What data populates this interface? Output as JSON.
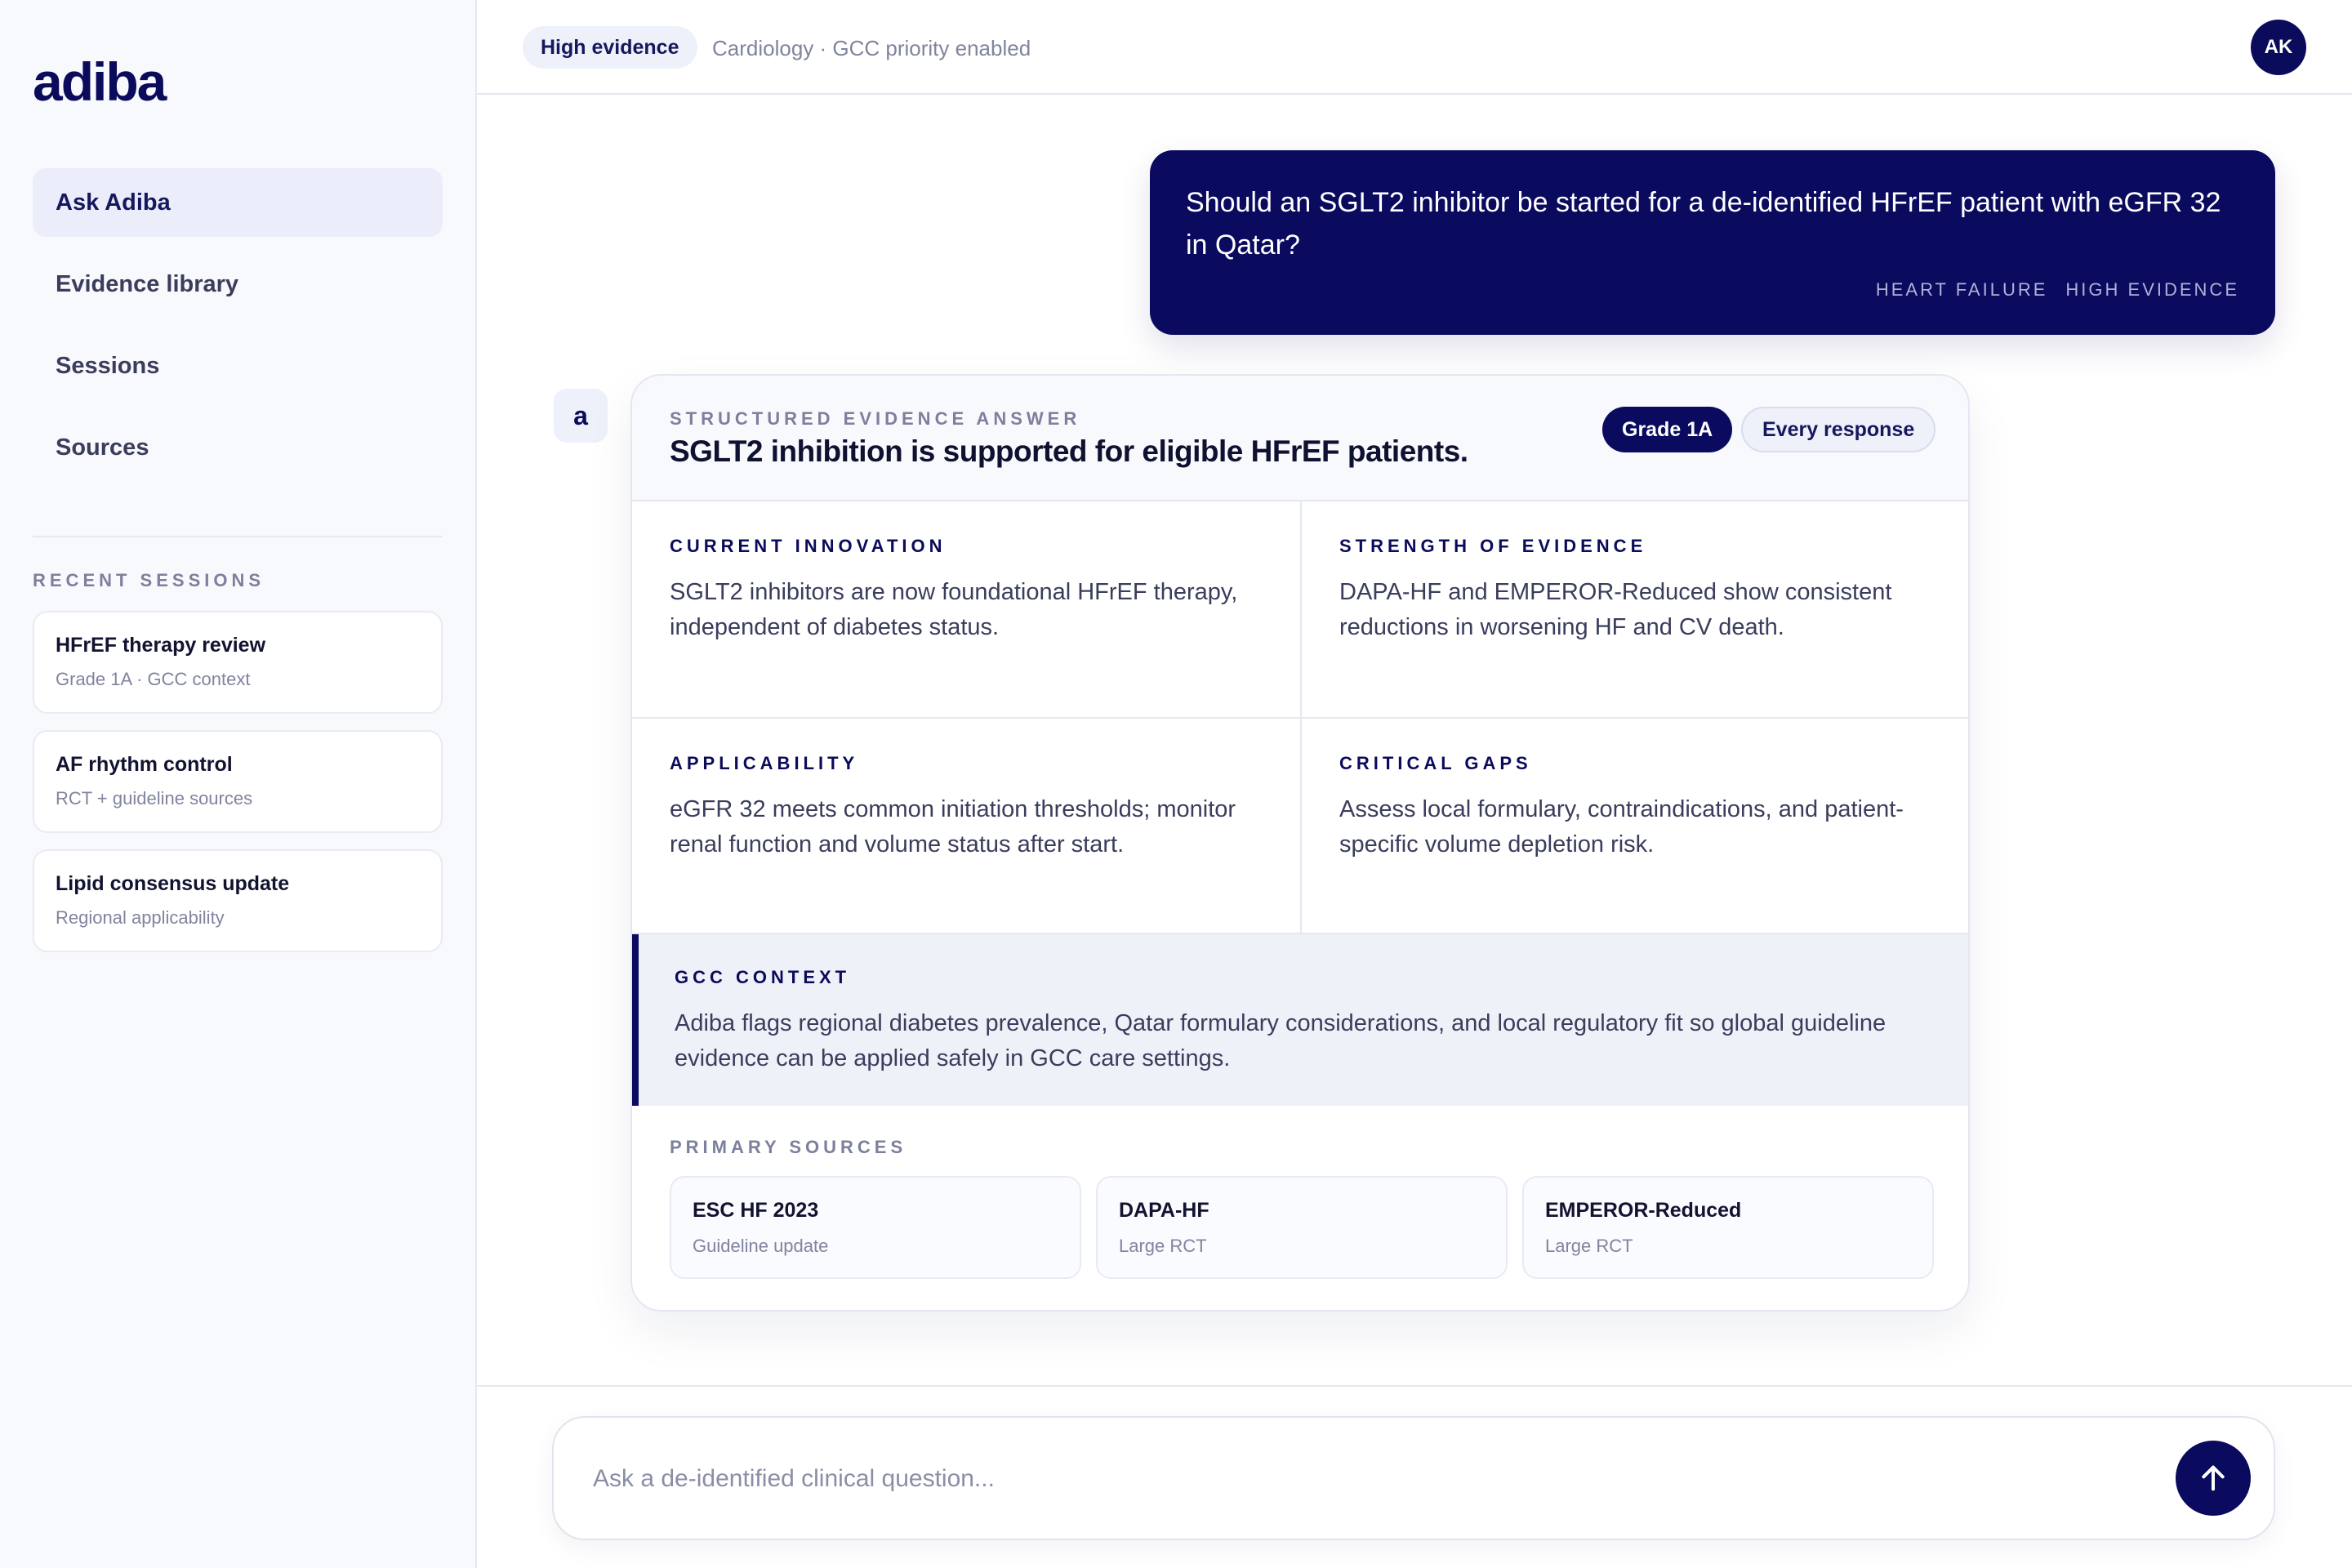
{
  "app": {
    "logo": "adiba"
  },
  "sidebar": {
    "nav": [
      {
        "label": "Ask Adiba",
        "active": true
      },
      {
        "label": "Evidence library",
        "active": false
      },
      {
        "label": "Sessions",
        "active": false
      },
      {
        "label": "Sources",
        "active": false
      }
    ],
    "recent_label": "RECENT SESSIONS",
    "sessions": [
      {
        "title": "HFrEF therapy review",
        "sub": "Grade 1A · GCC context"
      },
      {
        "title": "AF rhythm control",
        "sub": "RCT + guideline sources"
      },
      {
        "title": "Lipid consensus update",
        "sub": "Regional applicability"
      }
    ]
  },
  "header": {
    "evidence_pill": "High evidence",
    "context": "Cardiology · GCC priority enabled",
    "avatar_initials": "AK"
  },
  "user_message": {
    "text": "Should an SGLT2 inhibitor be started for a de-identified HFrEF patient with eGFR 32 in Qatar?",
    "tags": [
      "HEART FAILURE",
      "HIGH EVIDENCE"
    ]
  },
  "answer": {
    "avatar_letter": "a",
    "kicker": "STRUCTURED EVIDENCE ANSWER",
    "title": "SGLT2 inhibition is supported for eligible HFrEF patients.",
    "badges": {
      "grade": "Grade 1A",
      "scope": "Every response"
    },
    "cells": [
      {
        "kicker": "CURRENT INNOVATION",
        "text": "SGLT2 inhibitors are now foundational HFrEF therapy, independent of diabetes status."
      },
      {
        "kicker": "STRENGTH OF EVIDENCE",
        "text": "DAPA-HF and EMPEROR-Reduced show consistent reductions in worsening HF and CV death."
      },
      {
        "kicker": "APPLICABILITY",
        "text": "eGFR 32 meets common initiation thresholds; monitor renal function and volume status after start."
      },
      {
        "kicker": "CRITICAL GAPS",
        "text": "Assess local formulary, contraindications, and patient-specific volume depletion risk."
      }
    ],
    "gcc": {
      "kicker": "GCC CONTEXT",
      "text": "Adiba flags regional diabetes prevalence, Qatar formulary considerations, and local regulatory fit so global guideline evidence can be applied safely in GCC care settings."
    },
    "sources_label": "PRIMARY SOURCES",
    "sources": [
      {
        "name": "ESC HF 2023",
        "type": "Guideline update"
      },
      {
        "name": "DAPA-HF",
        "type": "Large RCT"
      },
      {
        "name": "EMPEROR-Reduced",
        "type": "Large RCT"
      }
    ]
  },
  "composer": {
    "placeholder": "Ask a de-identified clinical question...",
    "send_icon": "arrow-up-icon"
  },
  "colors": {
    "brand_navy": "#0a0a5e",
    "sidebar_bg": "#f8f9fd",
    "muted_text": "#80849e"
  }
}
